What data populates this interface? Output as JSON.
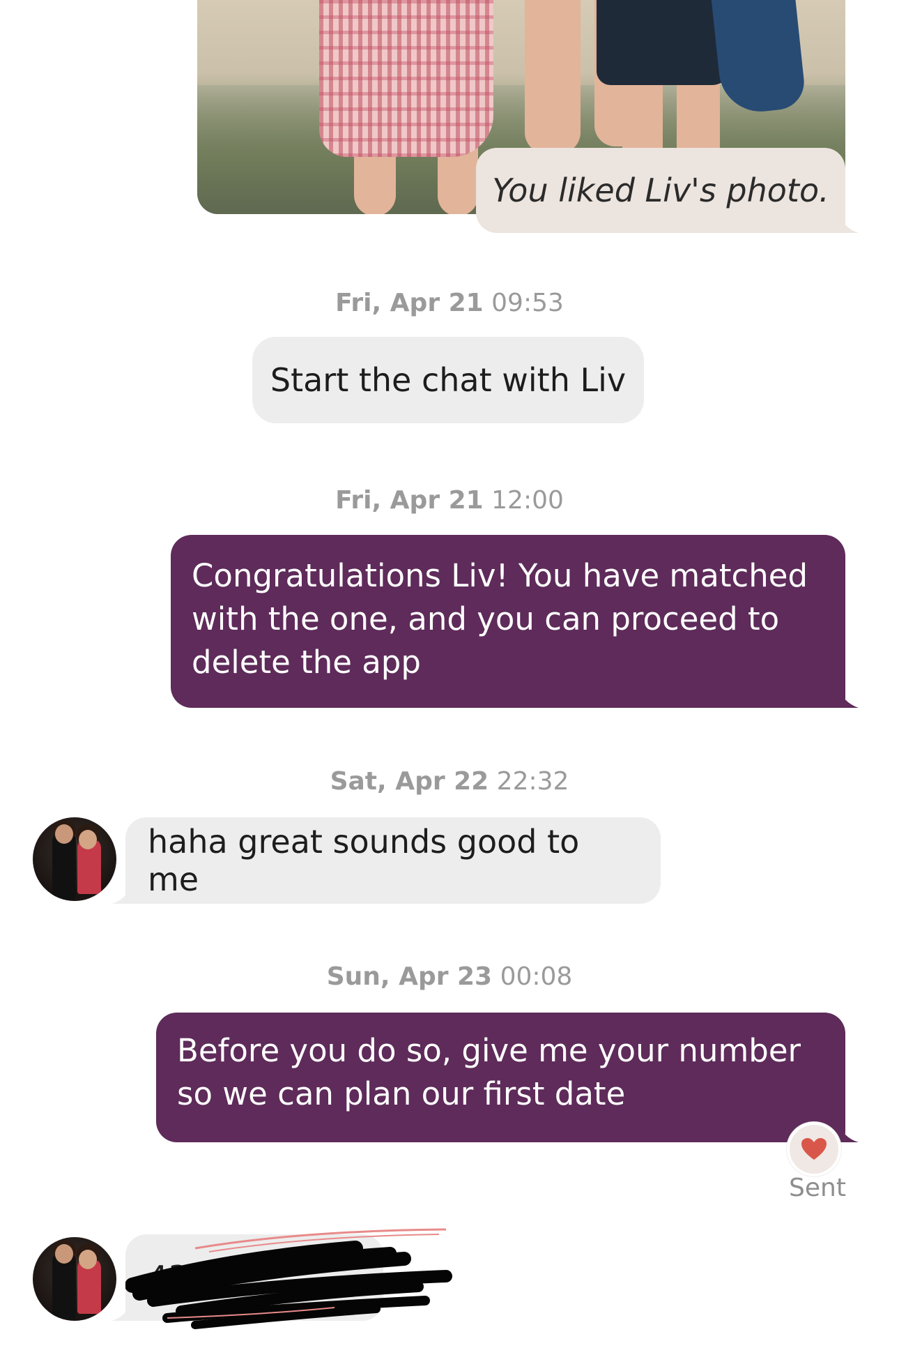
{
  "liked_photo": {
    "label": "You liked Liv's photo."
  },
  "messages": [
    {
      "day": "Fri, Apr 21",
      "time": "09:53",
      "type": "system",
      "text": "Start the chat with Liv"
    },
    {
      "day": "Fri, Apr 21",
      "time": "12:00",
      "type": "sent",
      "text": "Congratulations Liv! You have matched with the one, and you can proceed to delete the app"
    },
    {
      "day": "Sat, Apr 22",
      "time": "22:32",
      "type": "received",
      "text": "haha great sounds good to me"
    },
    {
      "day": "Sun, Apr 23",
      "time": "00:08",
      "type": "sent",
      "text": "Before you do so, give me your number so we can plan our first date",
      "status": "Sent"
    },
    {
      "type": "received",
      "text": "435"
    }
  ],
  "icons": {
    "reaction": "heart-icon",
    "avatar": "avatar"
  },
  "colors": {
    "sent_bubble": "#5e2b5a",
    "received_bubble": "#ededed",
    "liked_bubble": "#ece4de",
    "timestamp": "#9a9a9a",
    "heart": "#d9574a"
  }
}
